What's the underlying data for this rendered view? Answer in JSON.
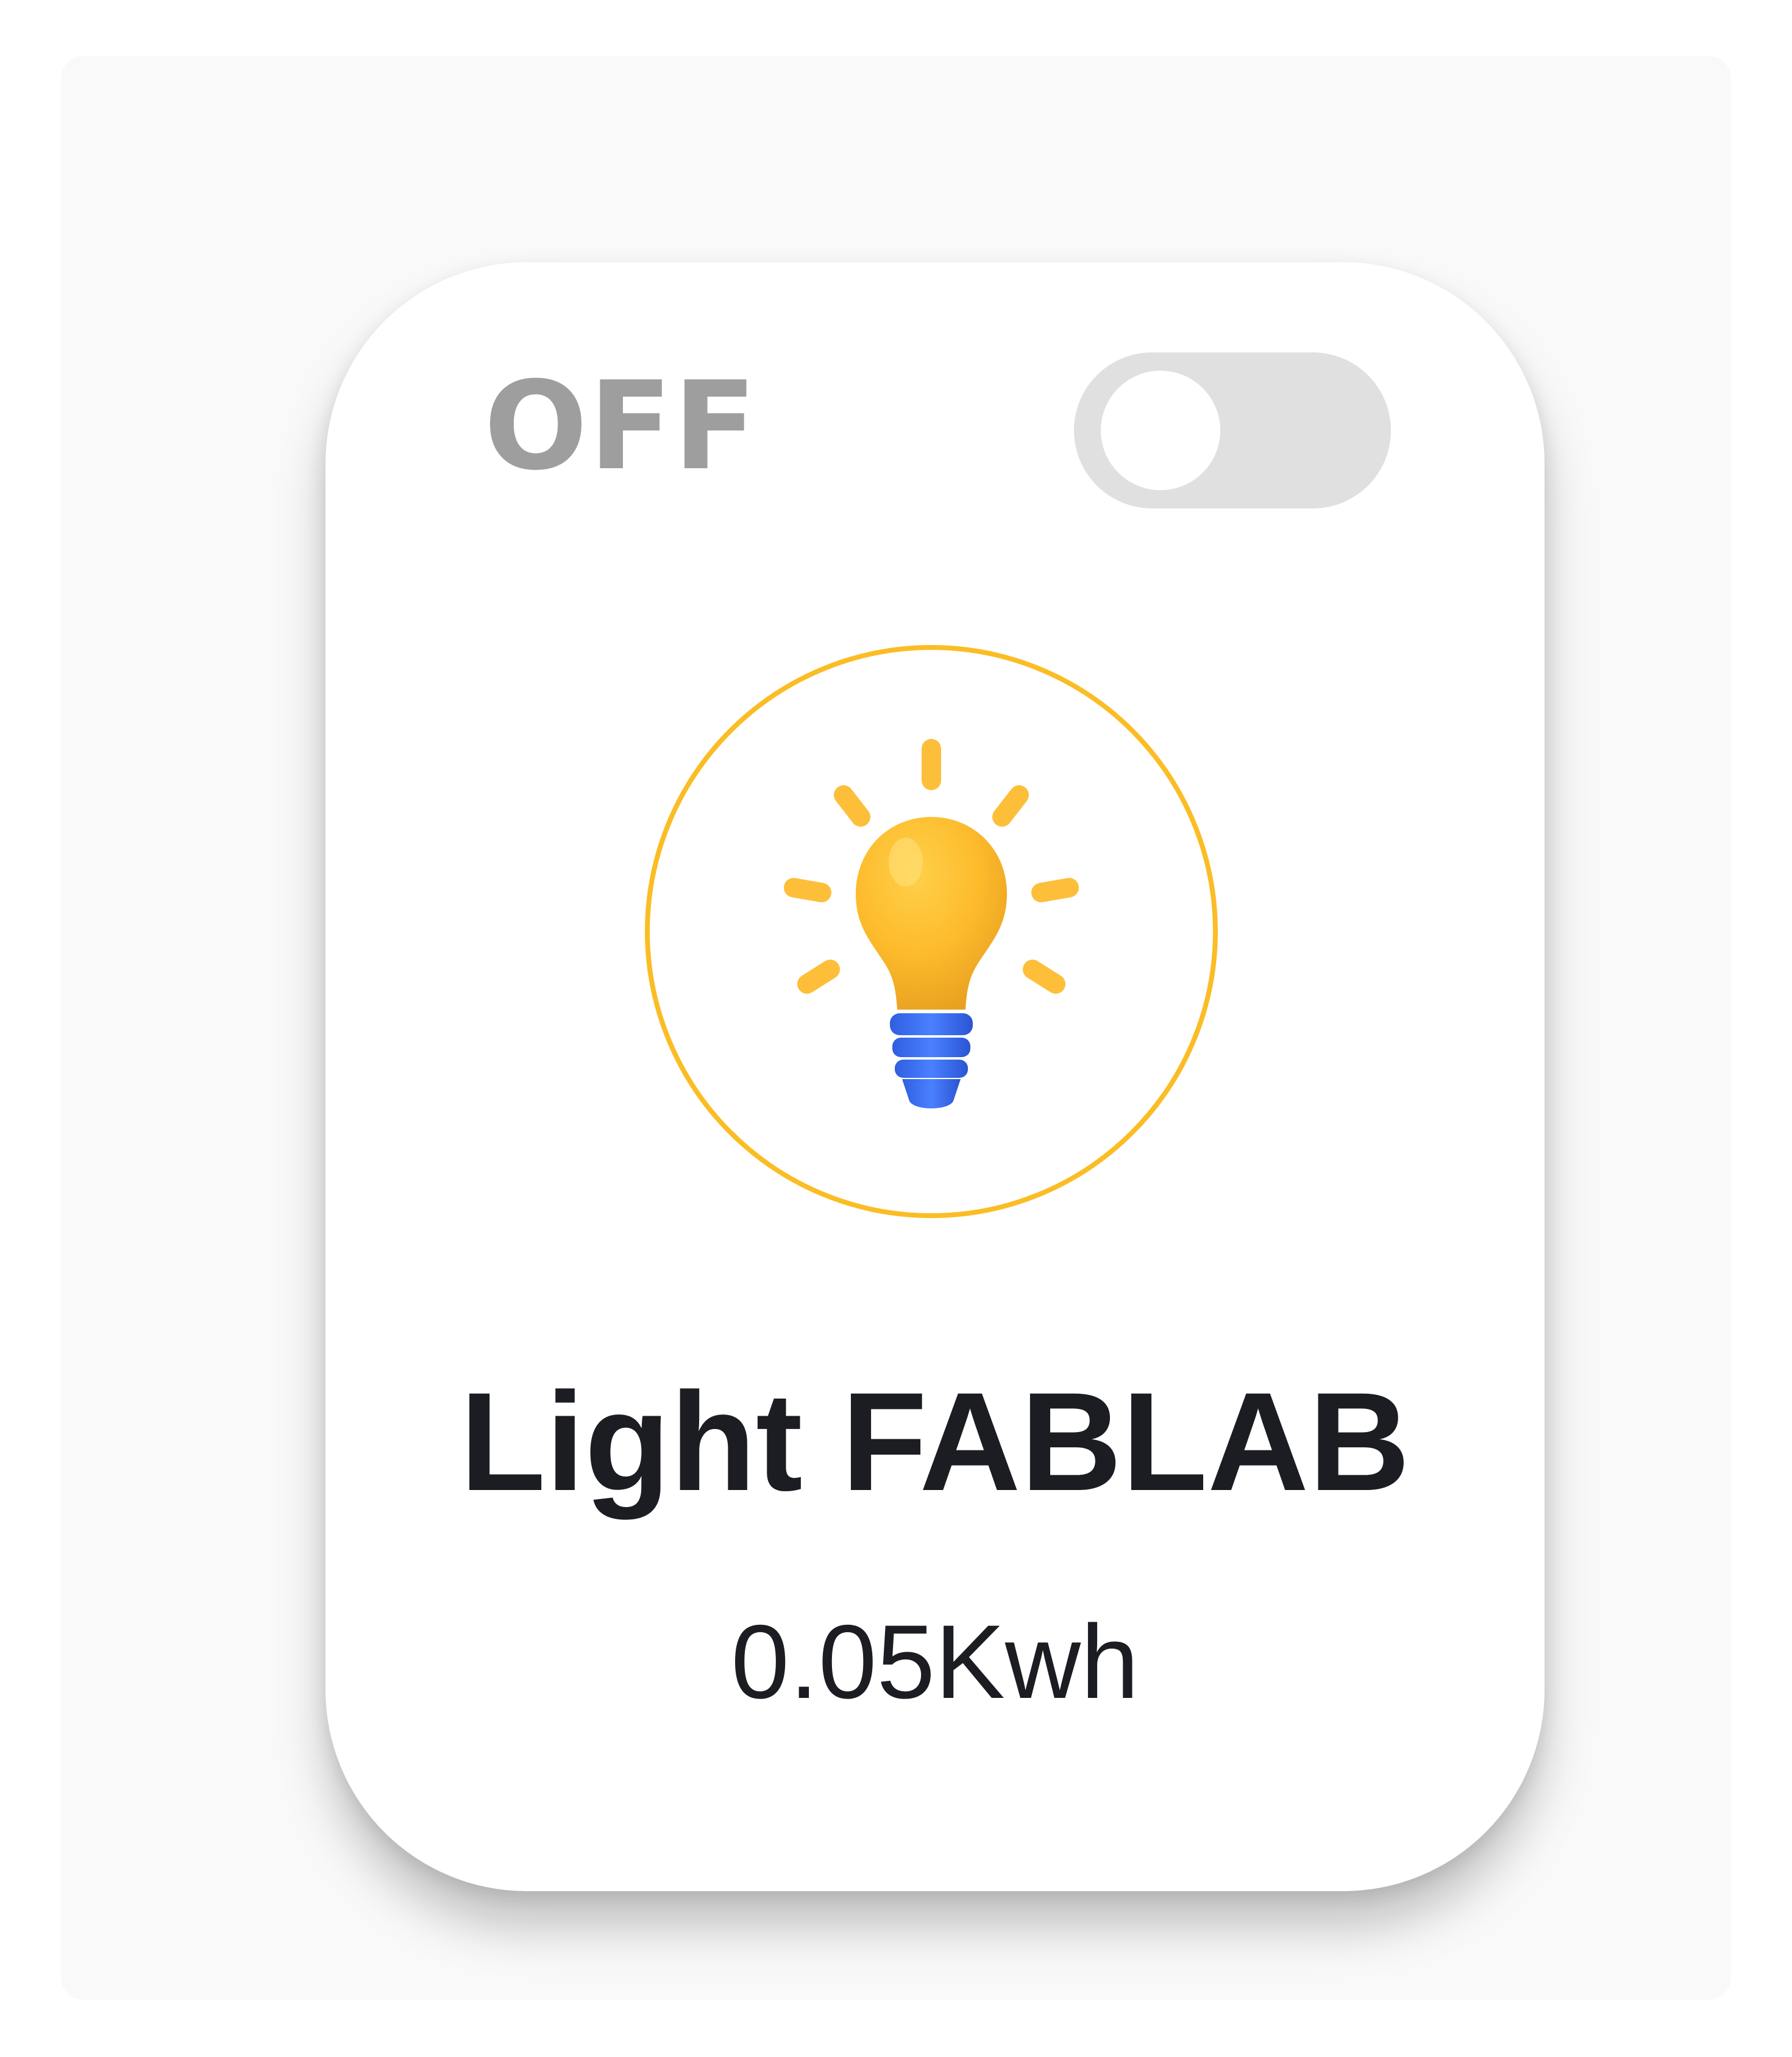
{
  "device": {
    "status_label": "OFF",
    "name": "Light FABLAB",
    "energy": "0.05Kwh",
    "is_on": false,
    "icon": "lightbulb-icon"
  },
  "colors": {
    "ring": "#fbbd25",
    "status_text": "#9e9e9e",
    "toggle_track": "#e0e0e0",
    "bulb_glass": "#fdbb2c",
    "bulb_base": "#3b6ef0",
    "title_text": "#1b1d22"
  }
}
